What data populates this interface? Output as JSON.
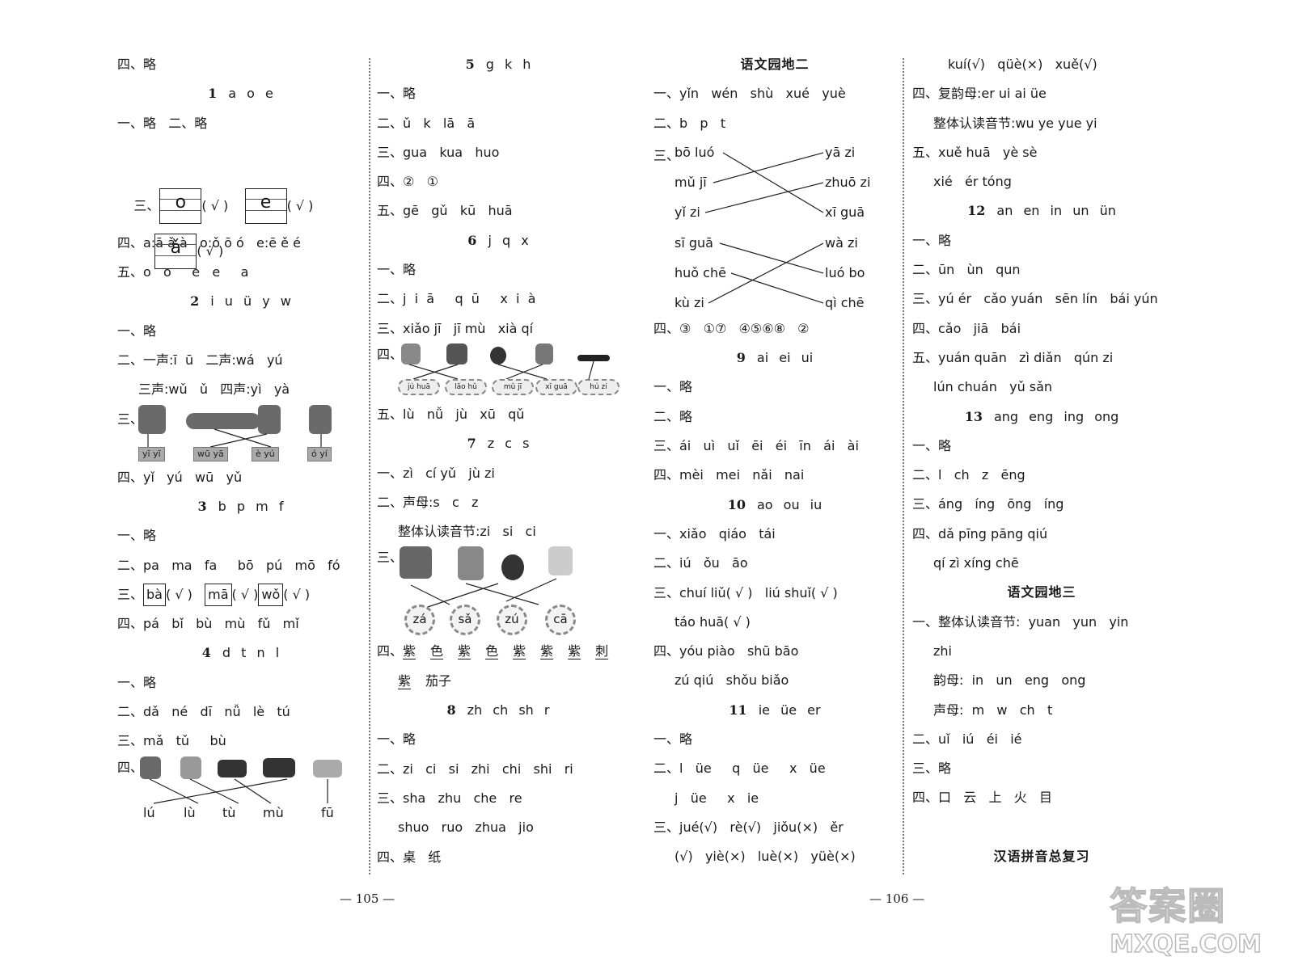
{
  "page_numbers": {
    "left": "— 105 —",
    "right": "— 106 —"
  },
  "watermark": {
    "line1": "答案圈",
    "line2": "MXQE.COM"
  },
  "col1": {
    "l0": "四、略",
    "s1": {
      "num": "1",
      "letters": "a o e"
    },
    "s1_l1": "一、略   二、略",
    "s1_l2_prefix": "三、",
    "s1_grid": [
      "o",
      "e",
      "ǎ"
    ],
    "check": "( √ )",
    "s1_l4": "四、a:ā ǎ à   o:ǒ ō ó   e:ē ě é",
    "s1_l5": "五、o   o     e   e     a",
    "s2": {
      "num": "2",
      "letters": "i u ü y w"
    },
    "s2_l1": "一、略",
    "s2_l2": "二、一声:ī  ū   二声:wá   yú",
    "s2_l3": "三声:wǔ   ǔ   四声:yì   yà",
    "s2_l4_prefix": "三、",
    "s2_tags": [
      "yī yī",
      "wū yā",
      "è yú",
      "ó yí"
    ],
    "s2_l5": "四、yǐ   yú   wū   yǔ",
    "s3": {
      "num": "3",
      "letters": "b p m f"
    },
    "s3_l1": "一、略",
    "s3_l2": "二、pa   ma   fa     bō   pú   mō   fó",
    "s3_l3_prefix": "三、",
    "s3_boxes": [
      "bà",
      "mā",
      "wǒ"
    ],
    "s3_l4": "四、pá   bǐ   bù   mù   fǔ   mǐ",
    "s4": {
      "num": "4",
      "letters": "d t n l"
    },
    "s4_l1": "一、略",
    "s4_l2": "二、dǎ   né   dī   nǚ   lè   tú",
    "s4_l3": "三、mǎ   tǔ     bù",
    "s4_l4_prefix": "四、",
    "s4_words": [
      "lú",
      "lù",
      "tù",
      "mù",
      "fū"
    ]
  },
  "col2": {
    "s5": {
      "num": "5",
      "letters": "g k h"
    },
    "s5_l1": "一、略",
    "s5_l2": "二、ǔ   k   lā   ā",
    "s5_l3": "三、gua   kua   huo",
    "s5_l4": "四、②   ①",
    "s5_l5": "五、gē   gǔ   kū   huā",
    "s6": {
      "num": "6",
      "letters": "j q x"
    },
    "s6_l1": "一、略",
    "s6_l2": "二、j  i  ā     q  ū     x  i  à",
    "s6_l3": "三、xiǎo jī   jī mù   xià qí",
    "s6_l4_prefix": "四、",
    "s6_clouds": [
      "jú huā",
      "lǎo hǔ",
      "mǔ jī",
      "xī guā",
      "hú zi"
    ],
    "s6_l5": "五、lù   nǚ   jù   xū   qǔ",
    "s7": {
      "num": "7",
      "letters": "z c s"
    },
    "s7_l1": "一、zì   cí yǔ   jù zi",
    "s7_l2": "二、声母:s   c   z",
    "s7_l3": "整体认读音节:zi   si   ci",
    "s7_l4_prefix": "三、",
    "s7_flowers": [
      "zá",
      "sǎ",
      "zú",
      "cā"
    ],
    "s7_l5_prefix": "四、",
    "s7_chars": [
      "紫",
      "色",
      "紫",
      "色",
      "紫",
      "紫",
      "紫",
      "刺"
    ],
    "s7_l6_chars": [
      "紫"
    ],
    "s7_l6_rest": "茄子",
    "s8": {
      "num": "8",
      "letters": "zh ch sh r"
    },
    "s8_l1": "一、略",
    "s8_l2": "二、zi   ci   si   zhi   chi   shi   ri",
    "s8_l3": "三、sha   zhu   che   re",
    "s8_l4": "shuo   ruo   zhua   jio",
    "s8_l5": "四、桌   纸"
  },
  "col3": {
    "title": "语文园地二",
    "l1": "一、yǐn   wén   shù   xué   yuè",
    "l2": "二、b   p   t",
    "l3_prefix": "三、",
    "match_left": [
      "bō luó",
      "mǔ jī",
      "yǐ zi",
      "sī guā",
      "huǒ chē",
      "kù zi"
    ],
    "match_right": [
      "yā zi",
      "zhuō zi",
      "xī guā",
      "wà zi",
      "luó bo",
      "qì chē"
    ],
    "l4": "四、③   ①⑦   ④⑤⑥⑧   ②",
    "s9": {
      "num": "9",
      "letters": "ai ei ui"
    },
    "s9_l1": "一、略",
    "s9_l2": "二、略",
    "s9_l3": "三、ái   uì   uǐ   ēi   éi   īn   ái   ài",
    "s9_l4": "四、mèi   mei   nǎi   nai",
    "s10": {
      "num": "10",
      "letters": "ao ou iu"
    },
    "s10_l1": "一、xiǎo   qiáo   tái",
    "s10_l2": "二、iú   ǒu   āo",
    "s10_l3": "三、chuí liǔ( √ )   liú shuǐ( √ )",
    "s10_l4": "táo huā( √ )",
    "s10_l5": "四、yóu piào   shū bāo",
    "s10_l6": "zú qiú   shǒu biǎo",
    "s11": {
      "num": "11",
      "letters": "ie üe er"
    },
    "s11_l1": "一、略",
    "s11_l2": "二、l   üe     q   üe     x   üe",
    "s11_l3": "j   üe     x   ie",
    "s11_l4": "三、jué(√)   rè(√)   jiǒu(×)   ěr",
    "s11_l5": "(√)   yiè(×)   luè(×)   yüè(×)"
  },
  "col4": {
    "l0": "kuí(√)   qüè(×)   xuě(√)",
    "l1": "四、复韵母:er ui ai üe",
    "l2": "整体认读音节:wu ye yue yi",
    "l3": "五、xuě huā   yè sè",
    "l4": "xié   ér tóng",
    "s12": {
      "num": "12",
      "letters": "an en in un ün"
    },
    "s12_l1": "一、略",
    "s12_l2": "二、ūn   ùn   qun",
    "s12_l3": "三、yú ér   cǎo yuán   sēn lín   bái yún",
    "s12_l4": "四、cǎo   jiā   bái",
    "s12_l5": "五、yuán quān   zì diǎn   qún zi",
    "s12_l6": "lún chuán   yǔ sǎn",
    "s13": {
      "num": "13",
      "letters": "ang eng ing ong"
    },
    "s13_l1": "一、略",
    "s13_l2": "二、l   ch   z   ēng",
    "s13_l3": "三、áng   íng   ōng   íng",
    "s13_l4": "四、dǎ pīng pāng qiú",
    "s13_l5": "qí zì xíng chē",
    "title3": "语文园地三",
    "t3_l1": "一、整体认读音节:  yuan   yun   yin",
    "t3_l2": "zhi",
    "t3_l3": "韵母:  in   un   eng   ong",
    "t3_l4": "声母:  m   w   ch   t",
    "t3_l5": "二、uǐ   iú   éi   ié",
    "t3_l6": "三、略",
    "t3_l7": "四、口   云   上   火   目",
    "final_title": "汉语拼音总复习"
  }
}
